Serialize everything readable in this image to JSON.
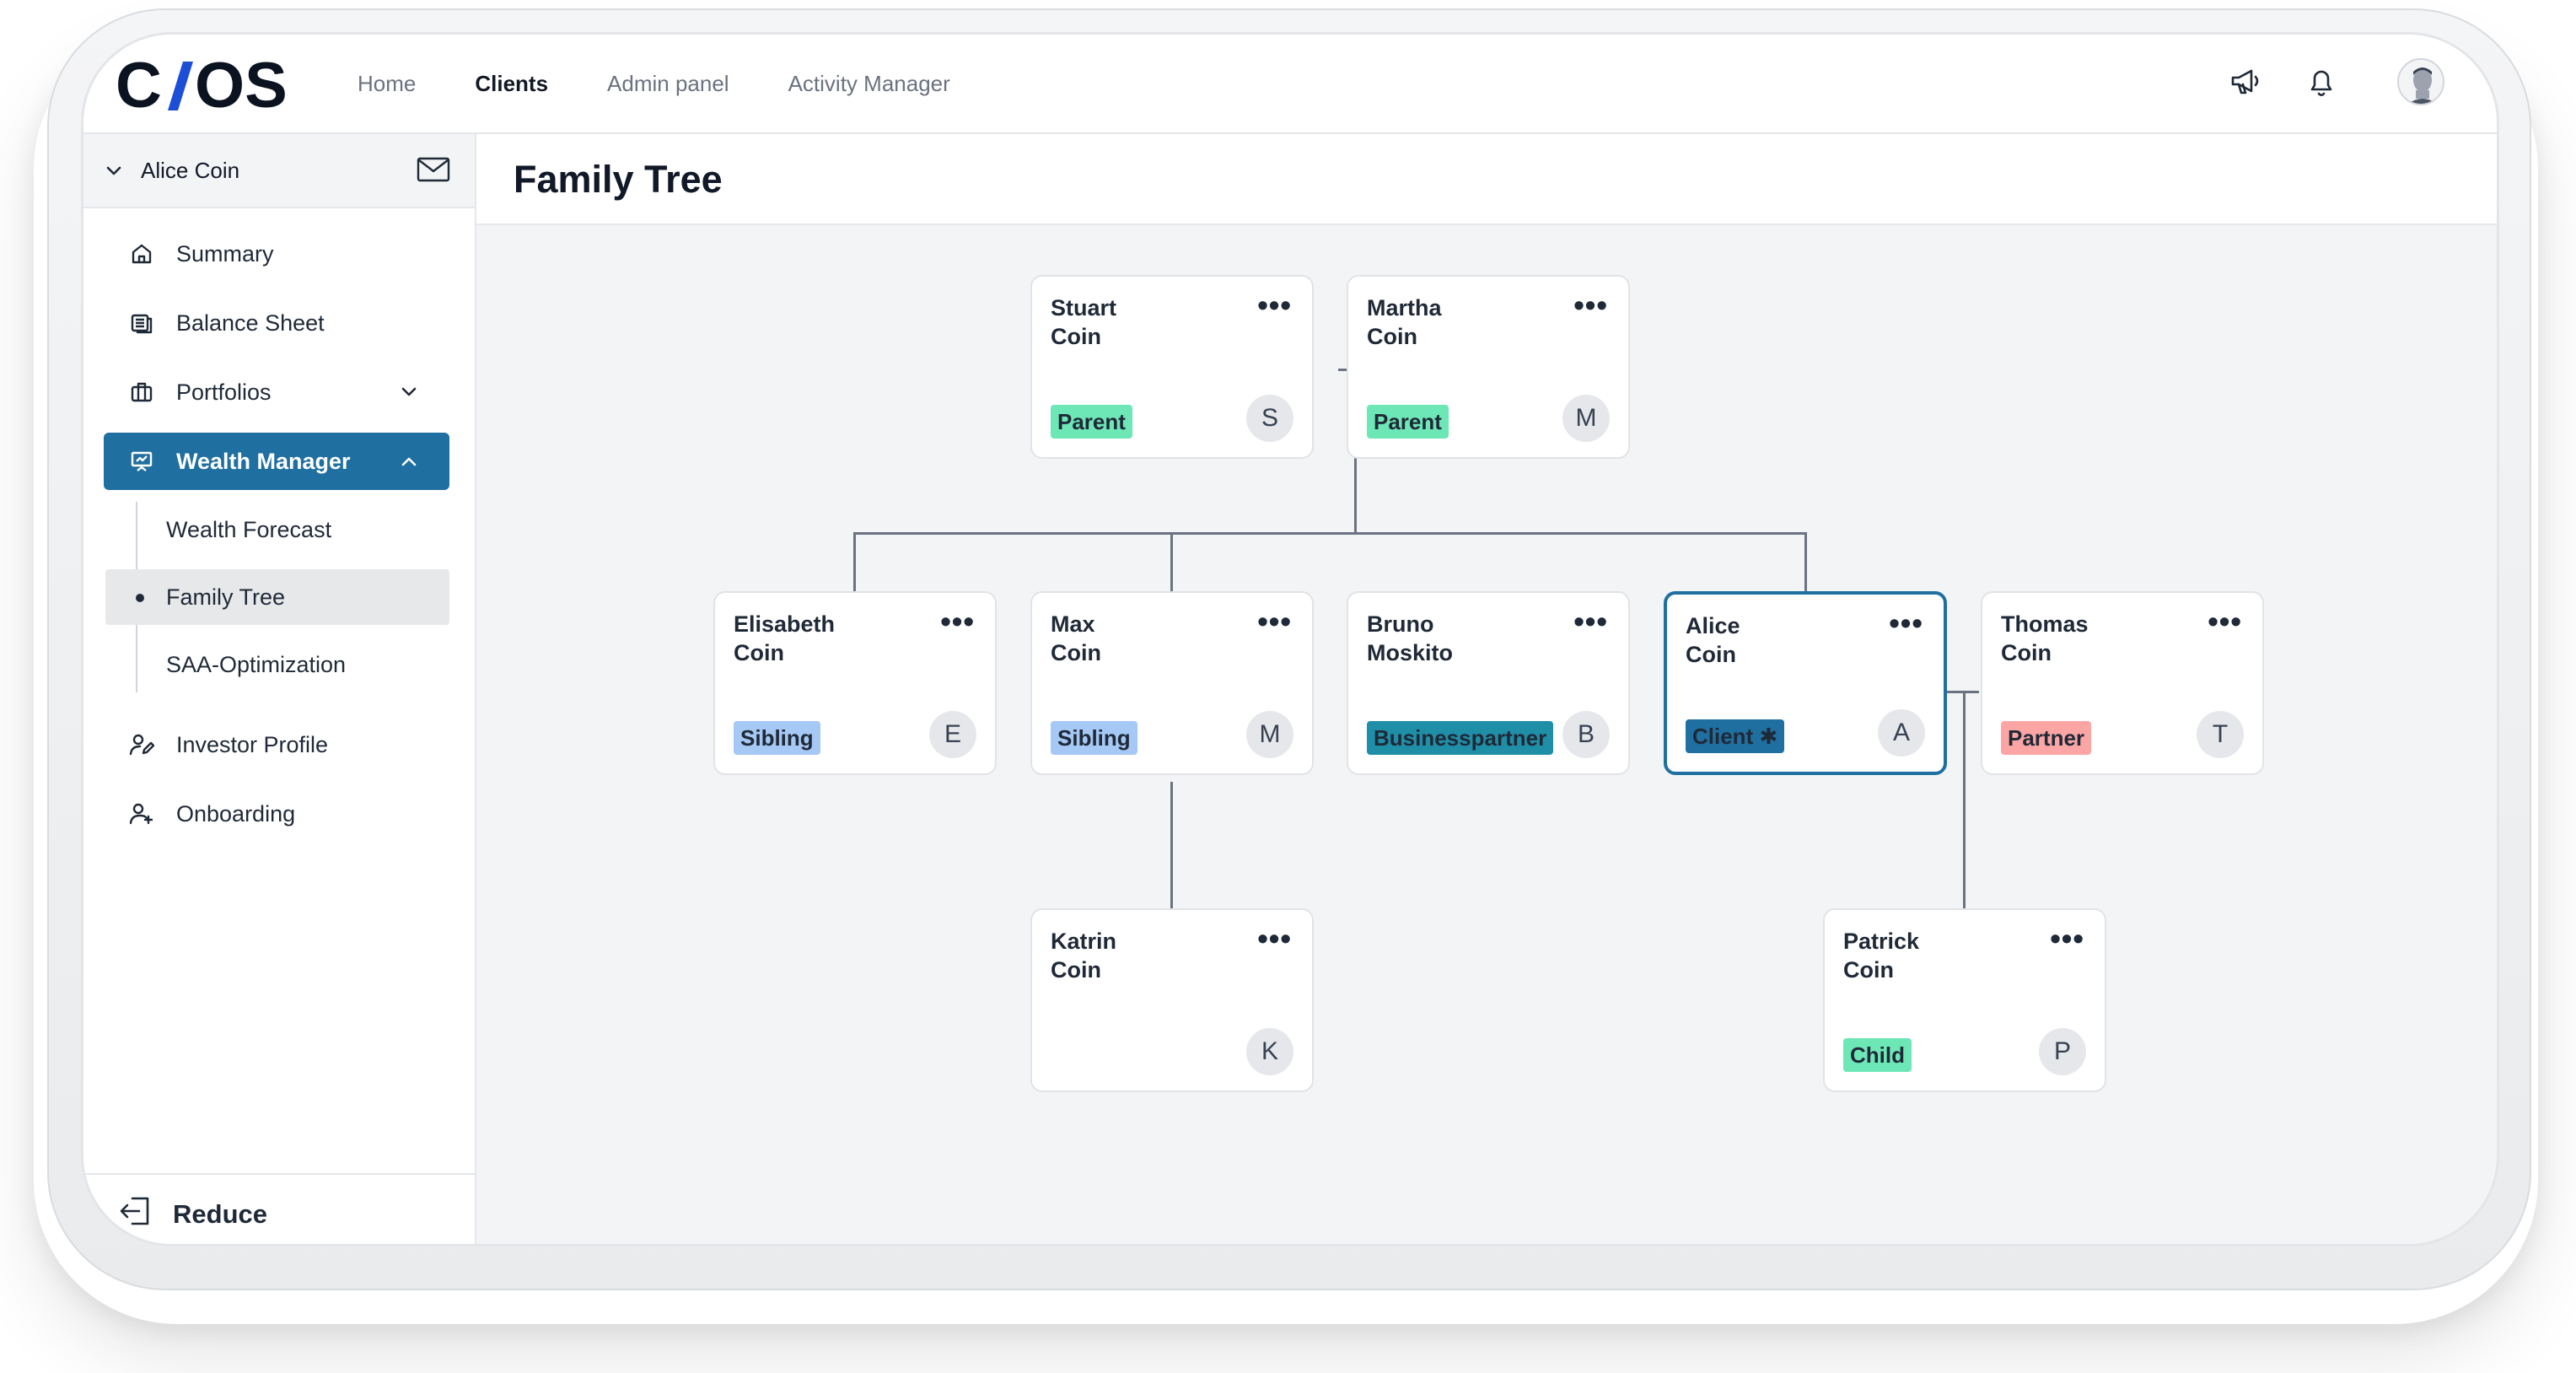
{
  "app": {
    "logo_text": "CIOS",
    "nav": [
      "Home",
      "Clients",
      "Admin panel",
      "Activity Manager"
    ],
    "nav_active_index": 1
  },
  "sidebar": {
    "client_name": "Alice Coin",
    "items": [
      {
        "label": "Summary",
        "icon": "home-icon"
      },
      {
        "label": "Balance Sheet",
        "icon": "ledger-icon"
      },
      {
        "label": "Portfolios",
        "icon": "briefcase-icon"
      },
      {
        "label": "Wealth Manager",
        "icon": "presentation-icon"
      }
    ],
    "wealth_submenu": [
      "Wealth Forecast",
      "Family Tree",
      "SAA-Optimization"
    ],
    "items_after": [
      {
        "label": "Investor Profile",
        "icon": "user-edit-icon"
      },
      {
        "label": "Onboarding",
        "icon": "user-plus-icon"
      }
    ],
    "reduce_label": "Reduce"
  },
  "main": {
    "title": "Family Tree"
  },
  "tree": {
    "parents": [
      {
        "first": "Stuart",
        "last": "Coin",
        "badge": "Parent",
        "initial": "S"
      },
      {
        "first": "Martha",
        "last": "Coin",
        "badge": "Parent",
        "initial": "M"
      }
    ],
    "middle": [
      {
        "first": "Elisabeth",
        "last": "Coin",
        "badge": "Sibling",
        "initial": "E"
      },
      {
        "first": "Max",
        "last": "Coin",
        "badge": "Sibling",
        "initial": "M"
      },
      {
        "first": "Bruno",
        "last": "Moskito",
        "badge": "Businesspartner",
        "initial": "B"
      },
      {
        "first": "Alice",
        "last": "Coin",
        "badge": "Client ✱",
        "initial": "A"
      },
      {
        "first": "Thomas",
        "last": "Coin",
        "badge": "Partner",
        "initial": "T"
      }
    ],
    "children": [
      {
        "first": "Katrin",
        "last": "Coin",
        "badge": "",
        "initial": "K"
      },
      {
        "first": "Patrick",
        "last": "Coin",
        "badge": "Child",
        "initial": "P"
      }
    ],
    "more_glyph": "•••"
  },
  "colors": {
    "accent": "#1f6fa1",
    "parent_badge": "#6ee7b7",
    "sibling_badge": "#a5c8f5",
    "business_badge": "#1f8fa8",
    "partner_badge": "#fca5a5"
  }
}
